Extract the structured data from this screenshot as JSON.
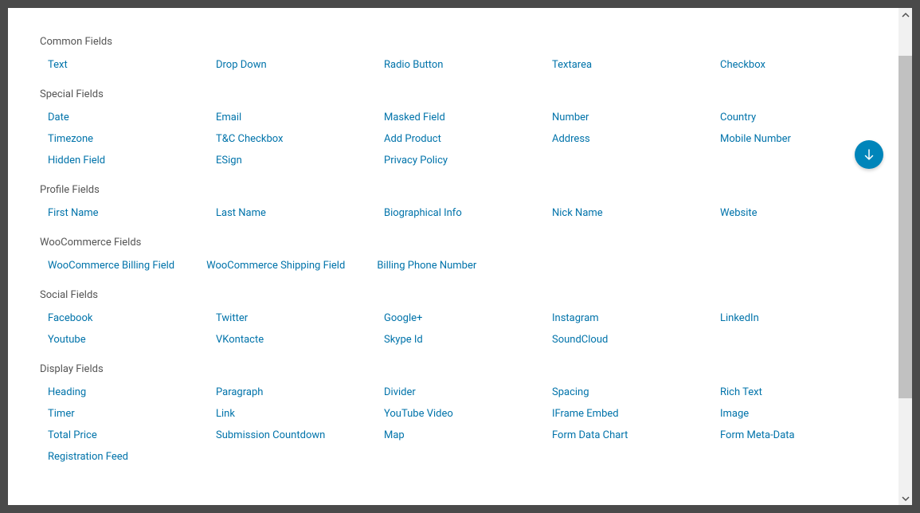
{
  "sections": [
    {
      "title": "Common Fields",
      "layout": "grid",
      "fields": [
        "Text",
        "Drop Down",
        "Radio Button",
        "Textarea",
        "Checkbox"
      ]
    },
    {
      "title": "Special Fields",
      "layout": "grid",
      "fields": [
        "Date",
        "Email",
        "Masked Field",
        "Number",
        "Country",
        "Timezone",
        "T&C Checkbox",
        "Add Product",
        "Address",
        "Mobile Number",
        "Hidden Field",
        "ESign",
        "Privacy Policy"
      ]
    },
    {
      "title": "Profile Fields",
      "layout": "grid",
      "fields": [
        "First Name",
        "Last Name",
        "Biographical Info",
        "Nick Name",
        "Website"
      ]
    },
    {
      "title": "WooCommerce Fields",
      "layout": "woo",
      "fields": [
        "WooCommerce Billing Field",
        "WooCommerce Shipping Field",
        "Billing Phone Number"
      ]
    },
    {
      "title": "Social Fields",
      "layout": "grid",
      "fields": [
        "Facebook",
        "Twitter",
        "Google+",
        "Instagram",
        "LinkedIn",
        "Youtube",
        "VKontacte",
        "Skype Id",
        "SoundCloud"
      ]
    },
    {
      "title": "Display Fields",
      "layout": "grid",
      "fields": [
        "Heading",
        "Paragraph",
        "Divider",
        "Spacing",
        "Rich Text",
        "Timer",
        "Link",
        "YouTube Video",
        "IFrame Embed",
        "Image",
        "Total Price",
        "Submission Countdown",
        "Map",
        "Form Data Chart",
        "Form Meta-Data",
        "Registration Feed"
      ]
    }
  ]
}
